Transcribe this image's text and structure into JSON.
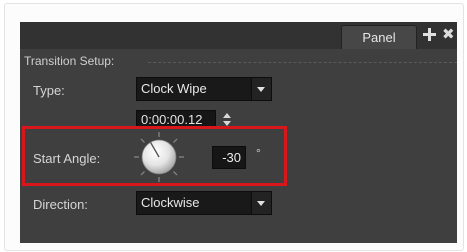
{
  "panel": {
    "tab_label": "Panel",
    "add_icon": "plus-icon",
    "close_icon": "close-icon",
    "close_glyph": "✖"
  },
  "transition_setup": {
    "title": "Transition Setup:",
    "type": {
      "label": "Type:",
      "value": "Clock Wipe"
    },
    "duration": {
      "value": "0:00:00.12"
    },
    "start_angle": {
      "label": "Start Angle:",
      "value": "-30",
      "unit": "°"
    },
    "direction": {
      "label": "Direction:",
      "value": "Clockwise"
    }
  },
  "colors": {
    "panel_bg": "#3f3f3f",
    "field_bg": "#191919",
    "highlight": "#d9171b"
  }
}
